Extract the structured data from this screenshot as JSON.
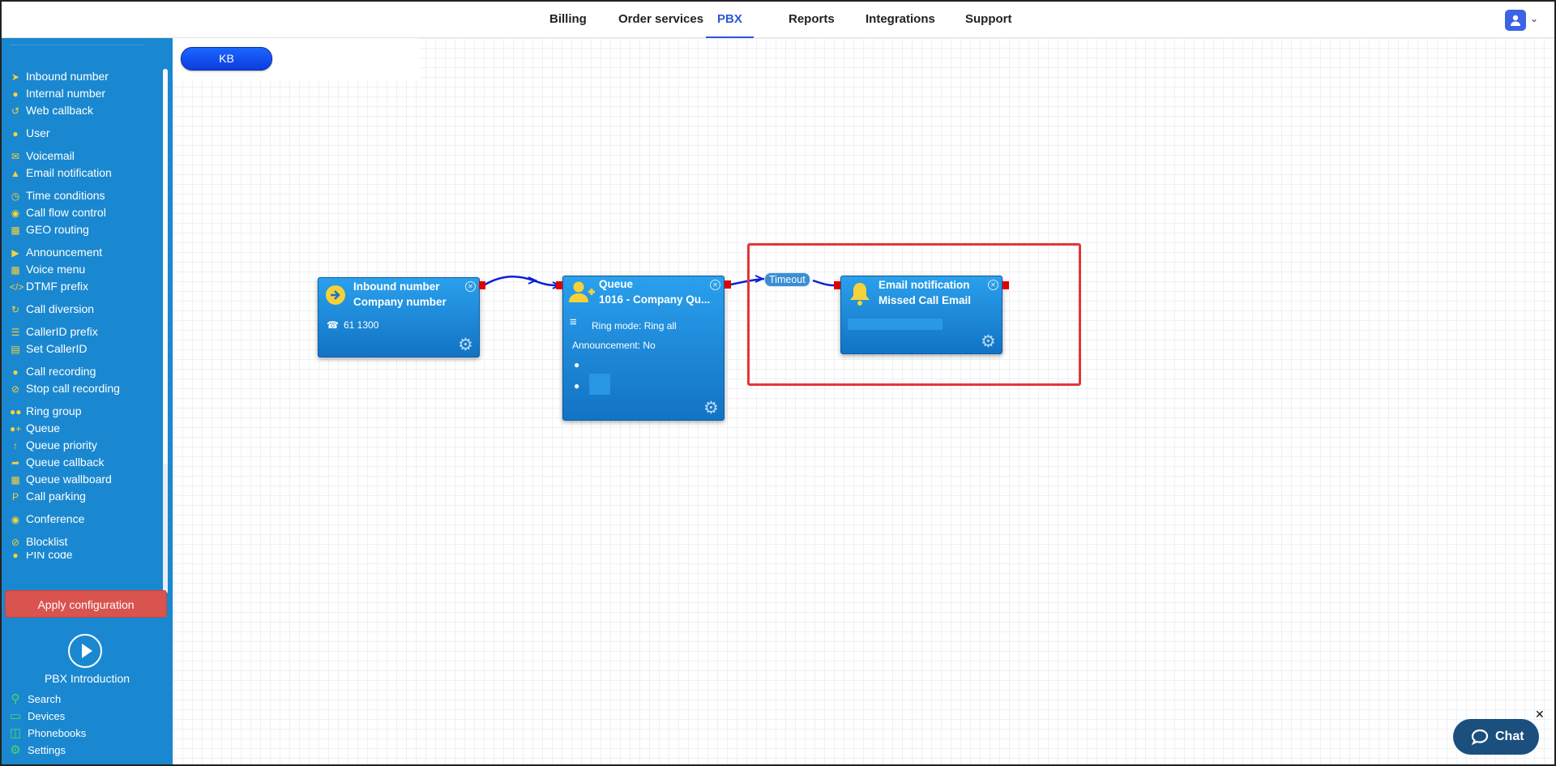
{
  "topnav": {
    "tabs": [
      {
        "label": "Billing"
      },
      {
        "label": "Order services"
      },
      {
        "label": "PBX",
        "active": true
      },
      {
        "label": "Reports"
      },
      {
        "label": "Integrations"
      },
      {
        "label": "Support"
      }
    ]
  },
  "sidebar": {
    "items": [
      {
        "label": "Inbound number",
        "icon": "arrow-circle-icon"
      },
      {
        "label": "Internal number",
        "icon": "map-pin-icon"
      },
      {
        "label": "Web callback",
        "icon": "callback-icon"
      },
      {
        "label": "User",
        "icon": "user-icon"
      },
      {
        "label": "Voicemail",
        "icon": "envelope-icon"
      },
      {
        "label": "Email notification",
        "icon": "bell-icon"
      },
      {
        "label": "Time conditions",
        "icon": "clock-icon"
      },
      {
        "label": "Call flow control",
        "icon": "toggle-icon"
      },
      {
        "label": "GEO routing",
        "icon": "sitemap-icon"
      },
      {
        "label": "Announcement",
        "icon": "megaphone-icon"
      },
      {
        "label": "Voice menu",
        "icon": "grid-icon"
      },
      {
        "label": "DTMF prefix",
        "icon": "code-icon"
      },
      {
        "label": "Call diversion",
        "icon": "redo-icon"
      },
      {
        "label": "CallerID prefix",
        "icon": "list-icon"
      },
      {
        "label": "Set CallerID",
        "icon": "id-card-icon"
      },
      {
        "label": "Call recording",
        "icon": "microphone-icon"
      },
      {
        "label": "Stop call recording",
        "icon": "microphone-slash-icon"
      },
      {
        "label": "Ring group",
        "icon": "users-icon"
      },
      {
        "label": "Queue",
        "icon": "user-plus-icon"
      },
      {
        "label": "Queue priority",
        "icon": "arrow-up-icon"
      },
      {
        "label": "Queue callback",
        "icon": "share-icon"
      },
      {
        "label": "Queue wallboard",
        "icon": "table-icon"
      },
      {
        "label": "Call parking",
        "icon": "parking-icon"
      },
      {
        "label": "Conference",
        "icon": "comments-icon"
      },
      {
        "label": "Blocklist",
        "icon": "ban-icon"
      },
      {
        "label": "PIN code",
        "icon": "lock-icon"
      }
    ],
    "apply_label": "Apply configuration",
    "intro_label": "PBX Introduction",
    "bottom": [
      {
        "label": "Search",
        "icon": "search-icon"
      },
      {
        "label": "Devices",
        "icon": "monitor-icon"
      },
      {
        "label": "Phonebooks",
        "icon": "book-icon"
      },
      {
        "label": "Settings",
        "icon": "gear-icon"
      }
    ]
  },
  "canvas": {
    "kb_label": "KB",
    "nodes": {
      "inbound": {
        "title1": "Inbound number",
        "title2": "Company number",
        "number": "61 1300"
      },
      "queue": {
        "title1": "Queue",
        "title2": "1016 - Company Qu...",
        "ring_mode": "Ring mode: Ring all",
        "announcement": "Announcement: No"
      },
      "email": {
        "title1": "Email notification",
        "title2": "Missed Call Email"
      }
    },
    "connection_label": "Timeout"
  },
  "chat": {
    "label": "Chat"
  },
  "colors": {
    "accent": "#2f56d6",
    "sidebar": "#1a88d0",
    "node": "#1a88d0",
    "apply": "#d9534f",
    "highlight": "#e3373a"
  }
}
